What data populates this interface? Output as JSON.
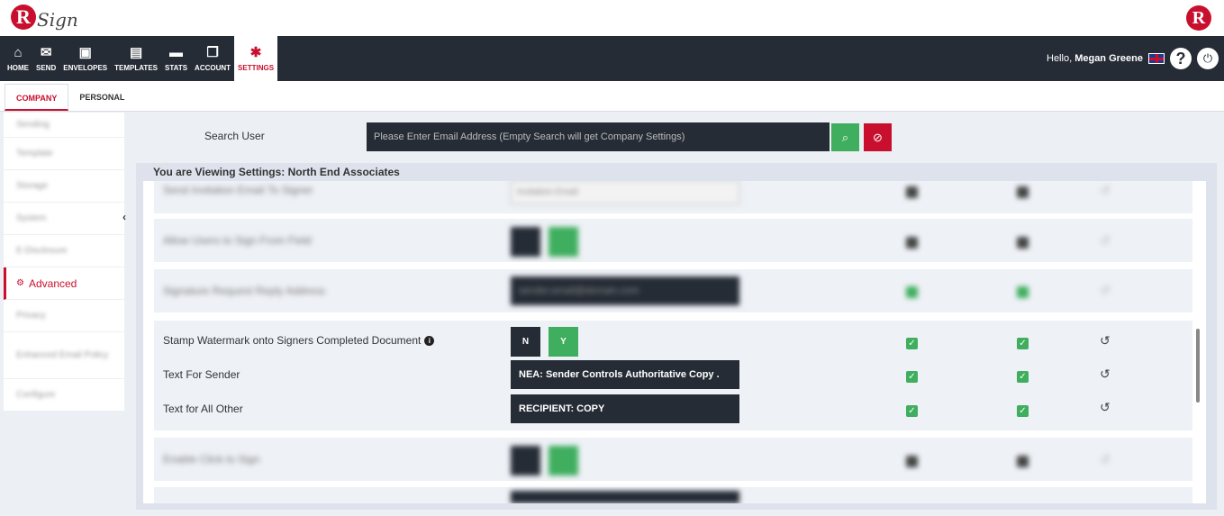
{
  "brand": {
    "logo_letter": "R",
    "logo_text": "Sign"
  },
  "nav": {
    "items": [
      {
        "label": "HOME",
        "icon": "home-icon"
      },
      {
        "label": "SEND",
        "icon": "envelope-icon"
      },
      {
        "label": "ENVELOPES",
        "icon": "inbox-icon"
      },
      {
        "label": "TEMPLATES",
        "icon": "templates-icon"
      },
      {
        "label": "STATS",
        "icon": "briefcase-icon"
      },
      {
        "label": "ACCOUNT",
        "icon": "account-icon"
      },
      {
        "label": "SETTINGS",
        "icon": "gear-icon"
      }
    ],
    "hello_prefix": "Hello,",
    "user_name": "Megan Greene",
    "help_glyph": "?"
  },
  "tabs": [
    {
      "label": "COMPANY"
    },
    {
      "label": "PERSONAL"
    }
  ],
  "sidebar": {
    "items": [
      {
        "label": "Sending"
      },
      {
        "label": "Template"
      },
      {
        "label": "Storage"
      },
      {
        "label": "System"
      },
      {
        "label": "E-Disclosure"
      },
      {
        "label": "Advanced"
      },
      {
        "label": "Privacy"
      },
      {
        "label": "Enhanced Email Policy"
      },
      {
        "label": "Configure"
      }
    ]
  },
  "search": {
    "label": "Search User",
    "placeholder": "Please Enter Email Address (Empty Search will get Company Settings)"
  },
  "viewing_text": "You are Viewing Settings: North End Associates",
  "settings": {
    "stamp_label": "Stamp Watermark onto Signers Completed Document",
    "toggle_n": "N",
    "toggle_y": "Y",
    "text_sender_label": "Text For Sender",
    "text_sender_value": "NEA: Sender Controls Authoritative Copy .",
    "text_other_label": "Text for All Other",
    "text_other_value": "RECIPIENT: COPY",
    "blurred_1": "Send Invitation Email To Signer",
    "blurred_1_value": "Invitation Email",
    "blurred_2": "Allow Users to Sign From Field",
    "blurred_3": "Signature Request Reply Address",
    "blurred_3_value": "sender.email@domain.com",
    "blurred_4": "Enable Click to Sign"
  },
  "colors": {
    "accent": "#c8102e",
    "dark": "#262c36",
    "green": "#3fae5e"
  }
}
